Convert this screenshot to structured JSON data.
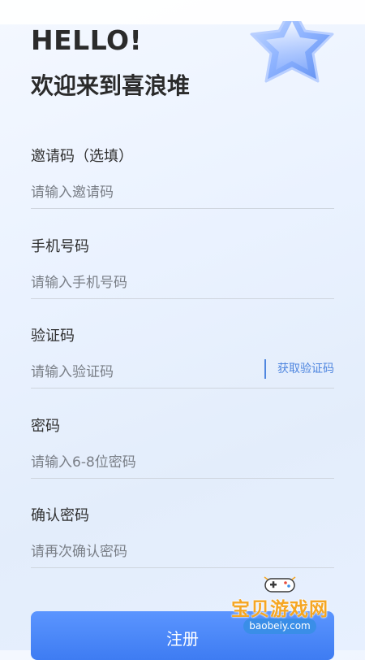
{
  "header": {
    "greeting": "HELLO!",
    "welcome": "欢迎来到喜浪堆"
  },
  "form": {
    "invite": {
      "label": "邀请码（选填）",
      "placeholder": "请输入邀请码"
    },
    "phone": {
      "label": "手机号码",
      "placeholder": "请输入手机号码"
    },
    "code": {
      "label": "验证码",
      "placeholder": "请输入验证码",
      "action": "获取验证码"
    },
    "password": {
      "label": "密码",
      "placeholder": "请输入6-8位密码"
    },
    "confirm": {
      "label": "确认密码",
      "placeholder": "请再次确认密码"
    }
  },
  "register_label": "注册",
  "watermark": {
    "text": "宝贝游戏网",
    "url": "baobeiy.com"
  },
  "colors": {
    "accent": "#4f86df",
    "button": "#3e7cf2",
    "watermark": "#f5a623"
  },
  "icons": [
    "star-icon",
    "gamepad-icon"
  ]
}
